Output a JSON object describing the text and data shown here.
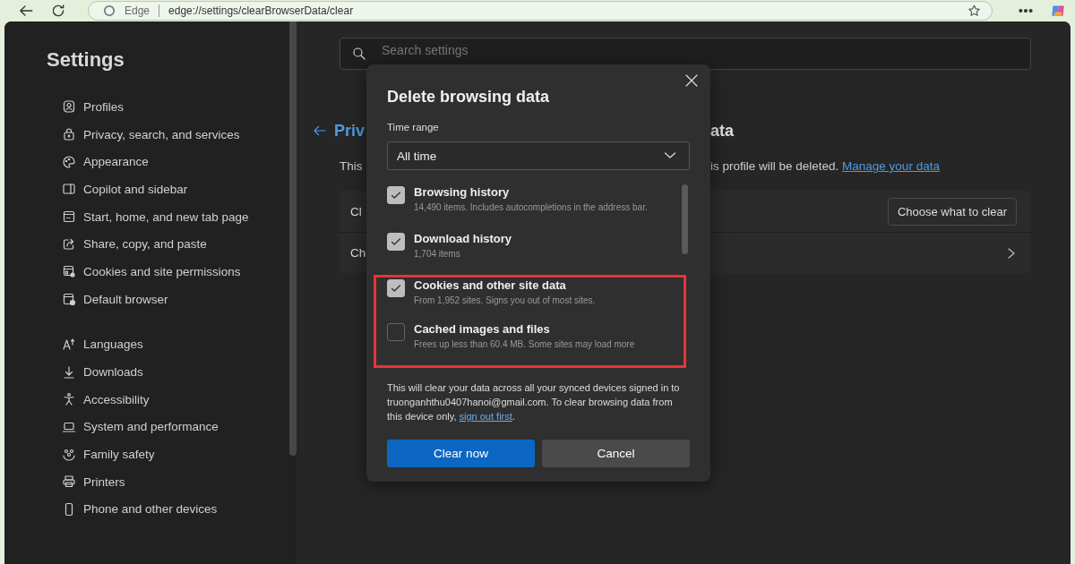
{
  "browser": {
    "brand": "Edge",
    "url": "edge://settings/clearBrowserData/clear"
  },
  "sidebar": {
    "title": "Settings",
    "groups": [
      {
        "items": [
          {
            "label": "Profiles"
          },
          {
            "label": "Privacy, search, and services"
          },
          {
            "label": "Appearance"
          },
          {
            "label": "Copilot and sidebar"
          },
          {
            "label": "Start, home, and new tab page"
          },
          {
            "label": "Share, copy, and paste"
          },
          {
            "label": "Cookies and site permissions"
          },
          {
            "label": "Default browser"
          }
        ]
      },
      {
        "items": [
          {
            "label": "Languages"
          },
          {
            "label": "Downloads"
          },
          {
            "label": "Accessibility"
          },
          {
            "label": "System and performance"
          },
          {
            "label": "Family safety"
          },
          {
            "label": "Printers"
          },
          {
            "label": "Phone and other devices"
          }
        ]
      }
    ]
  },
  "search": {
    "placeholder": "Search settings"
  },
  "page": {
    "title_start": "Priv",
    "title_end": "ata",
    "intro_start": "This",
    "intro_end": "is profile will be deleted.",
    "intro_link": "Manage your data",
    "rows": [
      {
        "label": "Cl",
        "action": "Choose what to clear"
      },
      {
        "label": "Ch"
      }
    ]
  },
  "dialog": {
    "title": "Delete browsing data",
    "time_range_label": "Time range",
    "time_range": "All time",
    "items": [
      {
        "title": "Browsing history",
        "detail": "14,490 items. Includes autocompletions in the address bar.",
        "checked": true,
        "highlighted": false
      },
      {
        "title": "Download history",
        "detail": "1,704 items",
        "checked": true,
        "highlighted": false
      },
      {
        "title": "Cookies and other site data",
        "detail": "From 1,952 sites. Signs you out of most sites.",
        "checked": true,
        "highlighted": true
      },
      {
        "title": "Cached images and files",
        "detail": "Frees up less than 60.4 MB. Some sites may load more",
        "checked": false,
        "highlighted": true
      }
    ],
    "note_start": "This will clear your data across all your synced devices signed in to truonganhthu0407hanoi@gmail.com. To clear browsing data from this device only, ",
    "note_link": "sign out first",
    "note_end": ".",
    "buttons": [
      {
        "label": "Clear now",
        "kind": "primary"
      },
      {
        "label": "Cancel",
        "kind": "secondary"
      }
    ]
  }
}
